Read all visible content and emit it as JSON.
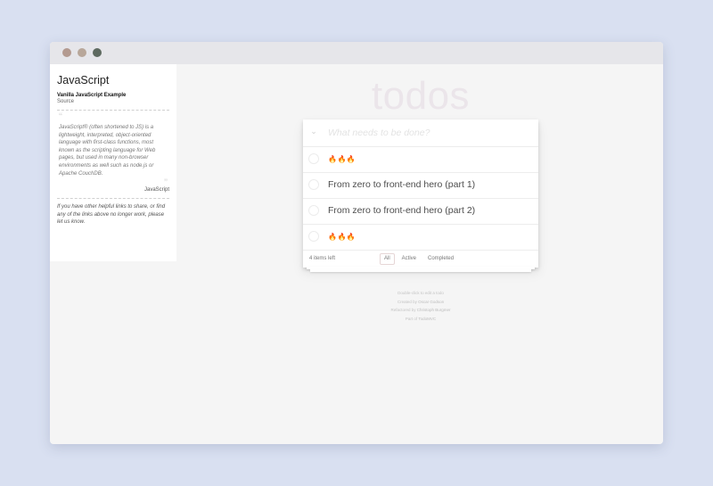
{
  "window": {
    "buttons": [
      "close",
      "minimize",
      "maximize"
    ]
  },
  "sidebar": {
    "title": "JavaScript",
    "subtitle": "Vanilla JavaScript Example",
    "source_link": "Source",
    "quote": "JavaScript® (often shortened to JS) is a lightweight, interpreted, object-oriented language with first-class functions, most known as the scripting language for Web pages, but used in many non-browser environments as well such as node.js or Apache CouchDB.",
    "quote_cite": "JavaScript",
    "footer_text": "If you have other helpful links to share, or find any of the links above no longer work, please let us know."
  },
  "app": {
    "title": "todos",
    "new_todo_placeholder": "What needs to be done?",
    "toggle_all_icon": "chevron-down-icon",
    "items": [
      {
        "label": "🔥🔥🔥",
        "completed": false
      },
      {
        "label": "From zero to front-end hero (part 1)",
        "completed": false
      },
      {
        "label": "From zero to front-end hero (part 2)",
        "completed": false
      },
      {
        "label": "🔥🔥🔥",
        "completed": false
      }
    ],
    "footer": {
      "count": "4 items left",
      "filters": [
        "All",
        "Active",
        "Completed"
      ],
      "selected_filter": "All"
    }
  },
  "info": {
    "line1": "Double-click to edit a todo",
    "line2_prefix": "Created by ",
    "line2_link": "Oscar Godson",
    "line3_prefix": "Refactored by ",
    "line3_link": "Christoph Burgmer",
    "line4_prefix": "Part of ",
    "line4_link": "TodoMVC"
  }
}
